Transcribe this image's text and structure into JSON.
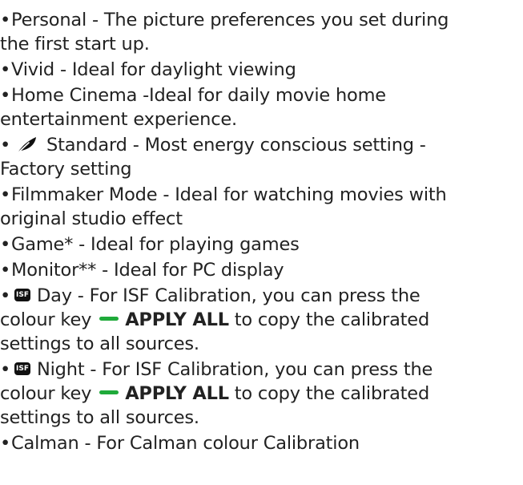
{
  "bullet": "•",
  "colors": {
    "green_key": "#1faa3a",
    "text": "#222222"
  },
  "items": [
    {
      "line1": "Personal - The picture preferences you set during",
      "line2": "the first start up."
    },
    {
      "line1": "Vivid - Ideal for daylight viewing"
    },
    {
      "line1": "Home Cinema -Ideal for daily movie home",
      "line2": "entertainment experience."
    },
    {
      "icon": "eco-leaf-icon",
      "line1": "Standard - Most energy conscious setting -",
      "line2": "Factory setting"
    },
    {
      "line1": "Filmmaker Mode - Ideal for watching movies with",
      "line2": "original studio effect"
    },
    {
      "line1": "Game* - Ideal for playing games"
    },
    {
      "line1": "Monitor** - Ideal for PC display"
    },
    {
      "icon": "isf-icon",
      "icon_text": "ISF",
      "line1": "Day - For ISF Calibration, you can press the",
      "line2_prefix": "colour key",
      "apply_label": "APPLY ALL",
      "line2_suffix": "to copy the calibrated",
      "line3": "settings to all sources."
    },
    {
      "icon": "isf-icon",
      "icon_text": "ISF",
      "line1": "Night - For ISF Calibration, you can press the",
      "line2_prefix": "colour key",
      "apply_label": "APPLY ALL",
      "line2_suffix": "to copy the calibrated",
      "line3": "settings to all sources."
    },
    {
      "line1": "Calman - For Calman colour Calibration"
    }
  ]
}
